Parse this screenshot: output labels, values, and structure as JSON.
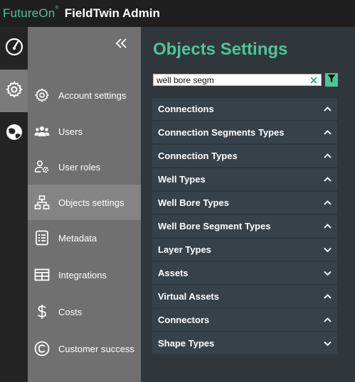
{
  "header": {
    "brand": "FutureOn",
    "brand_mark": "®",
    "title": "FieldTwin Admin"
  },
  "rail": {
    "items": [
      {
        "icon": "dashboard-gauge-icon",
        "active": false
      },
      {
        "icon": "gear-icon",
        "active": true
      },
      {
        "icon": "globe-icon",
        "active": false
      }
    ]
  },
  "sidebar": {
    "collapse_icon": "double-chevron-left-icon",
    "items": [
      {
        "label": "Account settings",
        "icon": "gear-icon"
      },
      {
        "label": "Users",
        "icon": "users-icon"
      },
      {
        "label": "User roles",
        "icon": "user-cog-icon"
      },
      {
        "label": "Objects settings",
        "icon": "hierarchy-icon",
        "active": true
      },
      {
        "label": "Metadata",
        "icon": "list-icon"
      },
      {
        "label": "Integrations",
        "icon": "table-icon"
      },
      {
        "label": "Costs",
        "icon": "dollar-icon"
      },
      {
        "label": "Customer success",
        "icon": "copyright-icon"
      }
    ]
  },
  "main": {
    "title": "Objects Settings",
    "search": {
      "value": "well bore segm",
      "placeholder": ""
    },
    "sections": [
      {
        "label": "Connections",
        "expanded": true
      },
      {
        "label": "Connection Segments Types",
        "expanded": true
      },
      {
        "label": "Connection Types",
        "expanded": true
      },
      {
        "label": "Well Types",
        "expanded": true
      },
      {
        "label": "Well Bore Types",
        "expanded": true
      },
      {
        "label": "Well Bore Segment Types",
        "expanded": true
      },
      {
        "label": "Layer Types",
        "expanded": false
      },
      {
        "label": "Assets",
        "expanded": false
      },
      {
        "label": "Virtual Assets",
        "expanded": true
      },
      {
        "label": "Connectors",
        "expanded": true
      },
      {
        "label": "Shape Types",
        "expanded": false
      }
    ]
  },
  "colors": {
    "accent": "#4fc49a",
    "topbar": "#1f1f1f",
    "rail": "#242424",
    "sidebar": "#707070",
    "sidebar_active": "#848484",
    "main_bg": "#2f373d",
    "row_bg": "#37414a"
  }
}
